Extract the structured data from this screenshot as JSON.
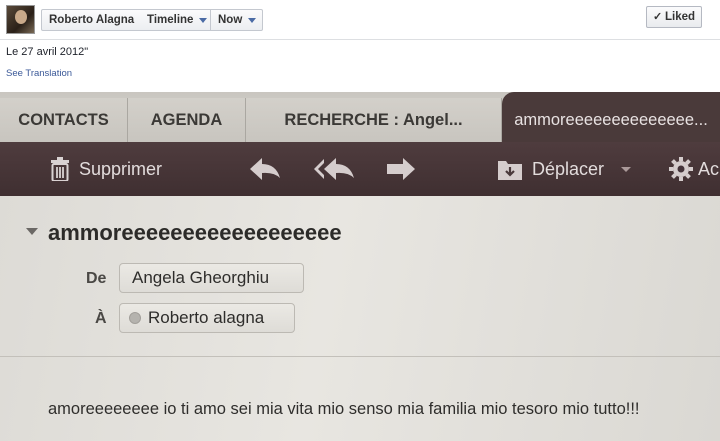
{
  "header": {
    "profile_name": "Roberto Alagna",
    "timeline_label": "Timeline",
    "now_label": "Now",
    "liked_label": "Liked"
  },
  "post": {
    "date_text": "Le 27 avril 2012\"",
    "see_translation": "See Translation"
  },
  "photo": {
    "tabs": [
      {
        "label": "CONTACTS"
      },
      {
        "label": "AGENDA"
      },
      {
        "label": "RECHERCHE : Angel..."
      },
      {
        "label": "ammoreeeeeeeeeeeeee..."
      }
    ],
    "toolbar": {
      "delete_label": "Supprimer",
      "move_label": "Déplacer",
      "actions_label": "Ac"
    },
    "message": {
      "subject": "ammoreeeeeeeeeeeeeeeeee",
      "from_label": "De",
      "from_value": "Angela Gheorghiu",
      "to_label": "À",
      "to_value": "Roberto alagna",
      "body": "amoreeeeeeee io ti amo sei mia vita mio senso mia familia mio tesoro mio tutto!!!"
    }
  },
  "colors": {
    "toolbar_bg": "#45353a",
    "active_tab_bg": "#4a3a3a",
    "fb_link": "#3b5998"
  }
}
